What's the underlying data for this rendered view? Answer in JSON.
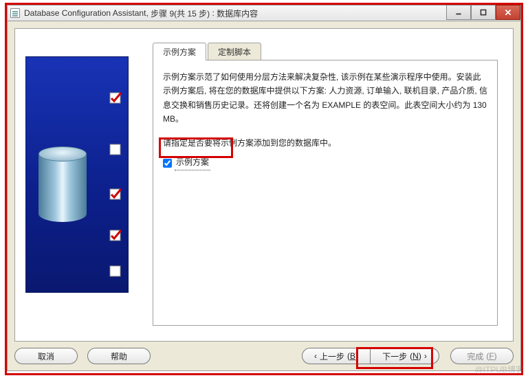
{
  "colors": {
    "highlight": "#d40000"
  },
  "title": {
    "app": "Database Configuration Assistant",
    "step_label": "步骤 9(共 15 步)",
    "page": "数据库内容"
  },
  "sidebar": {
    "checks": [
      {
        "kind": "checked"
      },
      {
        "kind": "empty"
      },
      {
        "kind": "checked"
      },
      {
        "kind": "checked"
      },
      {
        "kind": "empty"
      }
    ]
  },
  "tabs": {
    "items": [
      {
        "label": "示例方案",
        "active": true
      },
      {
        "label": "定制脚本",
        "active": false
      }
    ]
  },
  "content": {
    "description": "示例方案示范了如何使用分层方法来解决复杂性, 该示例在某些演示程序中使用。安装此示例方案后, 将在您的数据库中提供以下方案: 人力资源, 订单输入, 联机目录, 产品介质, 信息交换和销售历史记录。还将创建一个名为 EXAMPLE 的表空间。此表空间大小约为 130 MB。",
    "prompt": "请指定是否要将示例方案添加到您的数据库中。",
    "checkbox_label": "示例方案",
    "checkbox_checked": true
  },
  "buttons": {
    "cancel": "取消",
    "help": "帮助",
    "back": "上一步",
    "back_key": "B",
    "next": "下一步",
    "next_key": "N",
    "finish": "完成",
    "finish_key": "F"
  },
  "watermark": "@ITPUB博客"
}
